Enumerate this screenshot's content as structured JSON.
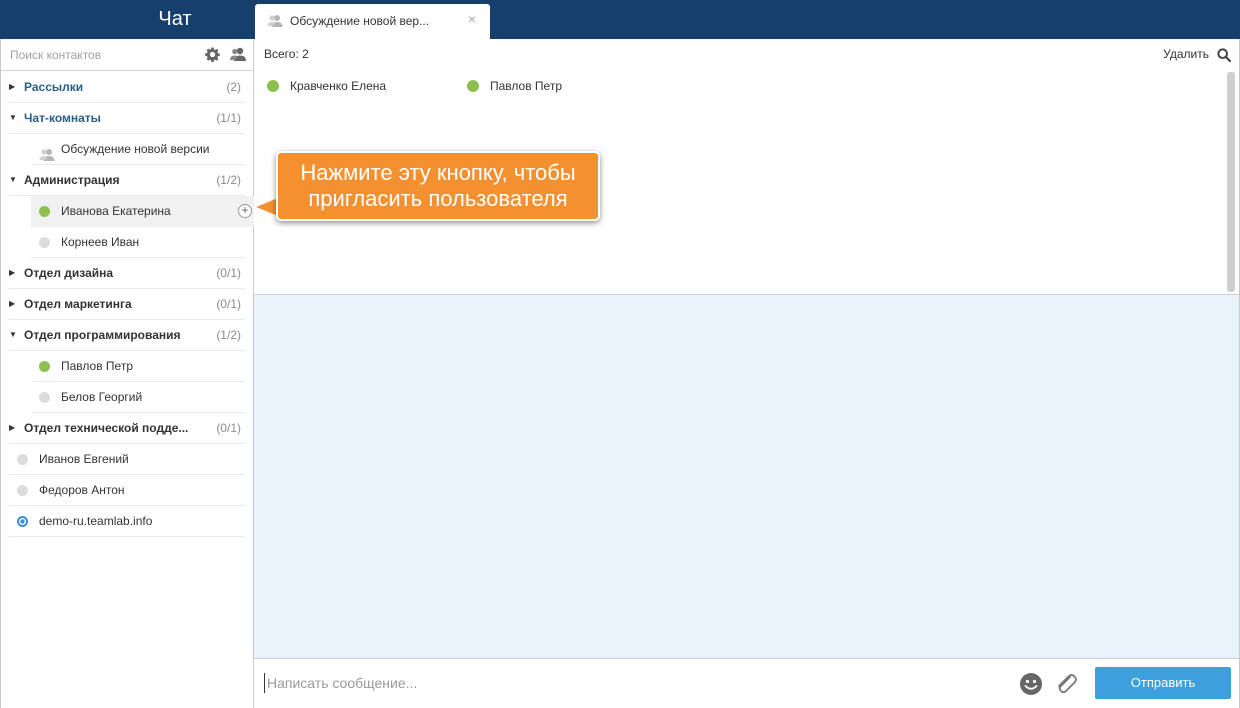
{
  "app": {
    "title": "Чат"
  },
  "tab": {
    "label": "Обсуждение новой вер...",
    "icon": "people-icon",
    "close_label": "×"
  },
  "sidebar": {
    "search_placeholder": "Поиск контактов",
    "rows": {
      "mailings": {
        "name": "Рассылки",
        "count": "(2)",
        "expanded": false
      },
      "chatrooms": {
        "name": "Чат-комнаты",
        "count": "(1/1)",
        "expanded": true
      },
      "room_discussion": {
        "name": "Обсуждение новой версии"
      },
      "admin": {
        "name": "Администрация",
        "count": "(1/2)",
        "expanded": true
      },
      "ivanova": {
        "name": "Иванова Екатерина",
        "status": "online"
      },
      "korneev": {
        "name": "Корнеев Иван",
        "status": "offline"
      },
      "design": {
        "name": "Отдел дизайна",
        "count": "(0/1)",
        "expanded": false
      },
      "marketing": {
        "name": "Отдел маркетинга",
        "count": "(0/1)",
        "expanded": false
      },
      "programming": {
        "name": "Отдел программирования",
        "count": "(1/2)",
        "expanded": true
      },
      "pavlov": {
        "name": "Павлов Петр",
        "status": "online"
      },
      "belov": {
        "name": "Белов Георгий",
        "status": "offline"
      },
      "support": {
        "name": "Отдел технической подде...",
        "count": "(0/1)",
        "expanded": false
      },
      "ivanov": {
        "name": "Иванов Евгений",
        "status": "offline"
      },
      "fedorov": {
        "name": "Федоров Антон",
        "status": "offline"
      },
      "demo": {
        "name": "demo-ru.teamlab.info",
        "status": "self"
      }
    },
    "invite_label": "+"
  },
  "callout": {
    "line1": "Нажмите эту кнопку, чтобы",
    "line2": "пригласить пользователя"
  },
  "members": {
    "total_label": "Всего: 2",
    "delete_label": "Удалить",
    "list": [
      "Кравченко Елена",
      "Павлов Петр"
    ]
  },
  "composer": {
    "placeholder": "Написать сообщение...",
    "send_label": "Отправить"
  },
  "colors": {
    "topbar": "#163f6d",
    "online": "#8cc152",
    "offline": "#dcdcdc",
    "accent_group": "#2a5f86",
    "callout": "#f39131",
    "send_button": "#3da0dc",
    "messages_bg": "#eaf3fb"
  }
}
